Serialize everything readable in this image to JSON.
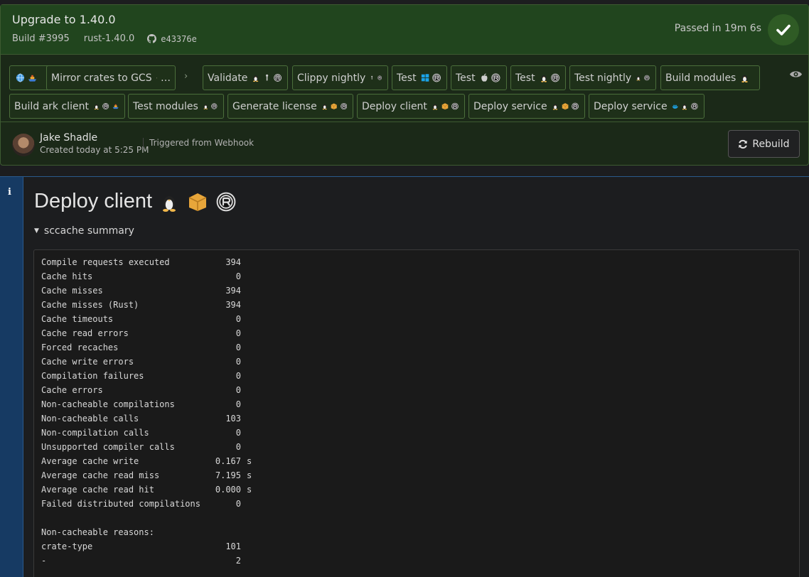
{
  "build": {
    "title": "Upgrade to 1.40.0",
    "number": "Build #3995",
    "branch": "rust-1.40.0",
    "commit": "e43376e",
    "status_text": "Passed in 19m 6s",
    "status_color": "#2f5b25"
  },
  "jobs": [
    {
      "label": "",
      "icons": [
        "globe-icon",
        "ship-icon"
      ]
    },
    {
      "label": "Mirror crates to GCS",
      "icons": [
        "linux-icon"
      ],
      "suffix": "…"
    },
    {
      "label": "Validate",
      "icons": [
        "linux-icon",
        "wrench-icon",
        "rust-icon"
      ]
    },
    {
      "label": "Clippy nightly",
      "icons": [
        "wrench-icon",
        "rust-icon"
      ]
    },
    {
      "label": "Test",
      "icons": [
        "windows-icon",
        "rust-icon"
      ]
    },
    {
      "label": "Test",
      "icons": [
        "apple-icon",
        "rust-icon"
      ]
    },
    {
      "label": "Test",
      "icons": [
        "linux-icon",
        "rust-icon"
      ]
    },
    {
      "label": "Test nightly",
      "icons": [
        "linux-icon",
        "rust-icon"
      ]
    },
    {
      "label": "Build modules",
      "icons": [
        "linux-icon"
      ]
    },
    {
      "label": "Build ark client",
      "icons": [
        "linux-icon",
        "rust-icon",
        "ship-icon"
      ]
    },
    {
      "label": "Test modules",
      "icons": [
        "linux-icon",
        "rust-icon"
      ]
    },
    {
      "label": "Generate license",
      "icons": [
        "linux-icon",
        "package-icon",
        "rust-icon"
      ]
    },
    {
      "label": "Deploy client",
      "icons": [
        "linux-icon",
        "package-icon",
        "rust-icon"
      ]
    },
    {
      "label": "Deploy service",
      "icons": [
        "linux-icon",
        "package-icon",
        "rust-icon"
      ]
    },
    {
      "label": "Deploy service",
      "icons": [
        "docker-icon",
        "linux-icon",
        "rust-icon"
      ]
    }
  ],
  "author": {
    "name": "Jake Shadle",
    "created": "Created today at 5:25 PM",
    "trigger": "Triggered from Webhook"
  },
  "rebuild_label": "Rebuild",
  "job_detail": {
    "title": "Deploy client",
    "title_icons": [
      "linux-icon",
      "package-icon",
      "rust-icon"
    ],
    "summary_label": "sccache summary",
    "stats": [
      {
        "key": "Compile requests executed",
        "value": "394",
        "unit": ""
      },
      {
        "key": "Cache hits",
        "value": "0",
        "unit": ""
      },
      {
        "key": "Cache misses",
        "value": "394",
        "unit": ""
      },
      {
        "key": "Cache misses (Rust)",
        "value": "394",
        "unit": ""
      },
      {
        "key": "Cache timeouts",
        "value": "0",
        "unit": ""
      },
      {
        "key": "Cache read errors",
        "value": "0",
        "unit": ""
      },
      {
        "key": "Forced recaches",
        "value": "0",
        "unit": ""
      },
      {
        "key": "Cache write errors",
        "value": "0",
        "unit": ""
      },
      {
        "key": "Compilation failures",
        "value": "0",
        "unit": ""
      },
      {
        "key": "Cache errors",
        "value": "0",
        "unit": ""
      },
      {
        "key": "Non-cacheable compilations",
        "value": "0",
        "unit": ""
      },
      {
        "key": "Non-cacheable calls",
        "value": "103",
        "unit": ""
      },
      {
        "key": "Non-compilation calls",
        "value": "0",
        "unit": ""
      },
      {
        "key": "Unsupported compiler calls",
        "value": "0",
        "unit": ""
      },
      {
        "key": "Average cache write",
        "value": "0.167",
        "unit": "s"
      },
      {
        "key": "Average cache read miss",
        "value": "7.195",
        "unit": "s"
      },
      {
        "key": "Average cache read hit",
        "value": "0.000",
        "unit": "s"
      },
      {
        "key": "Failed distributed compilations",
        "value": "0",
        "unit": ""
      }
    ],
    "reasons_heading": "Non-cacheable reasons:",
    "reasons": [
      {
        "key": "crate-type",
        "value": "101"
      },
      {
        "key": "-",
        "value": "2"
      }
    ]
  }
}
